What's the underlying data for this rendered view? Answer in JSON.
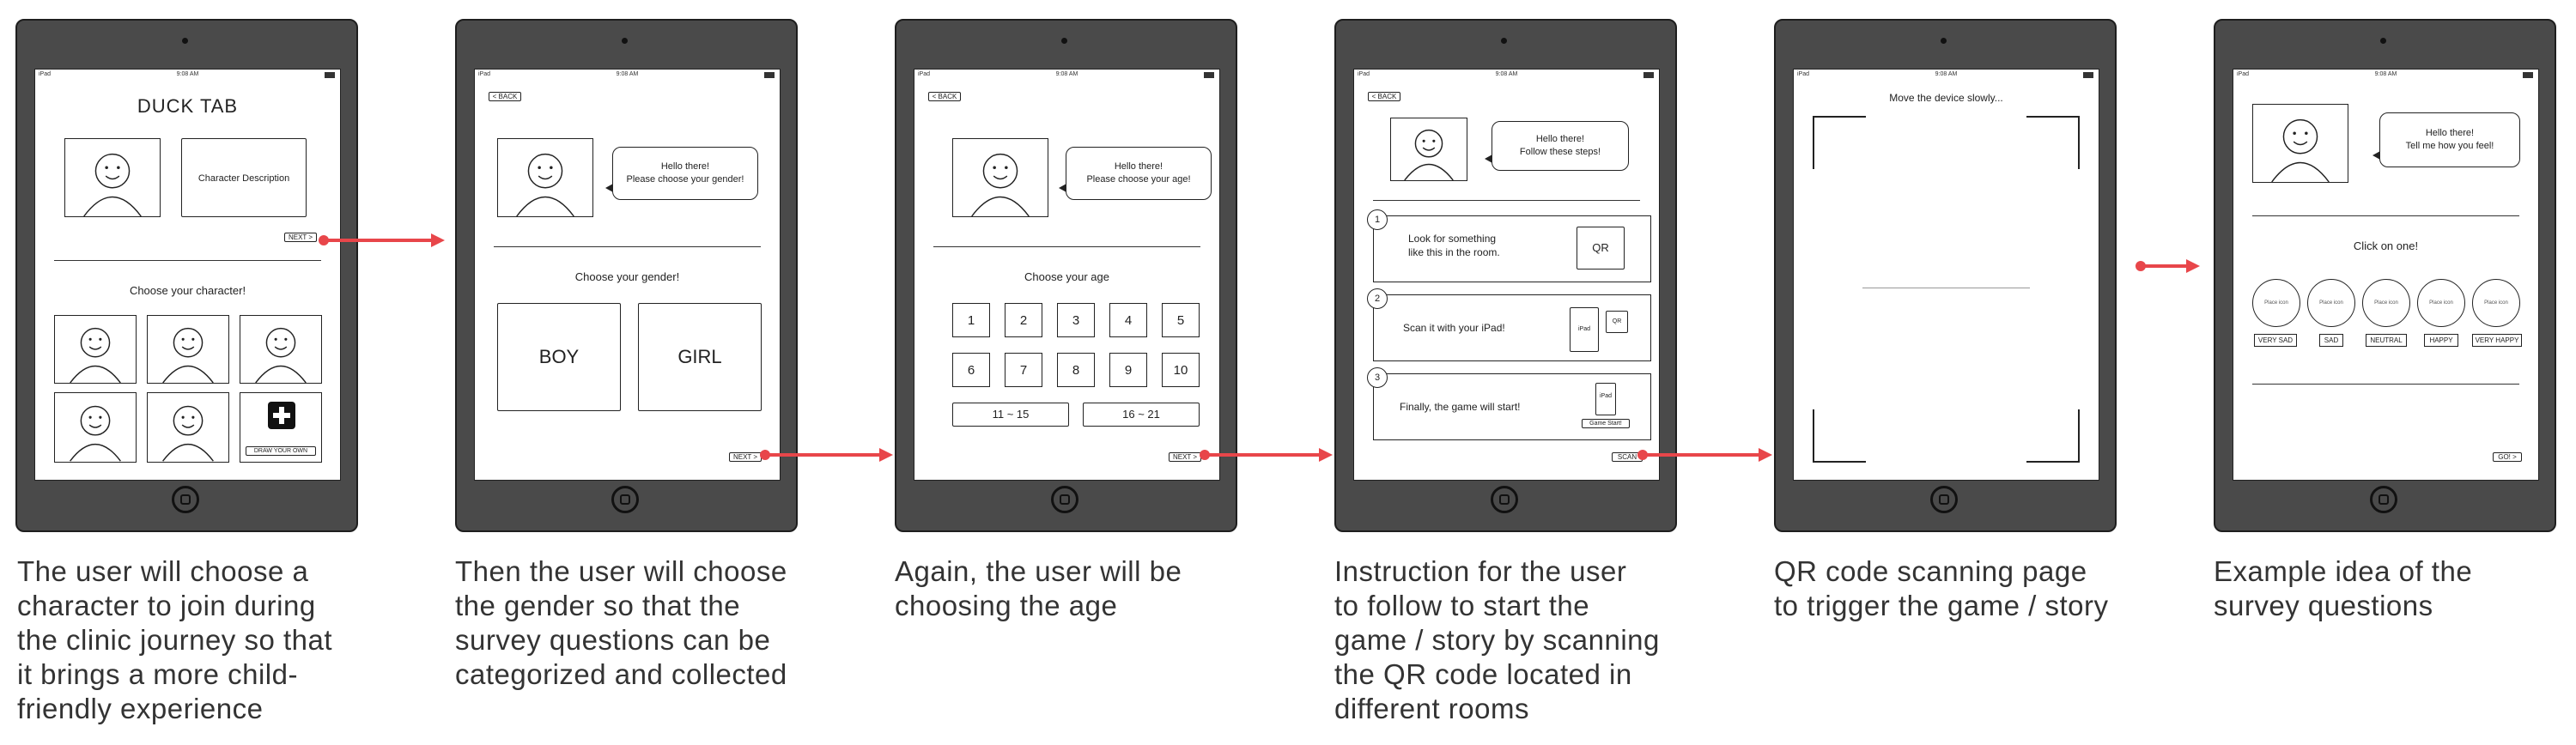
{
  "status": {
    "carrier": "iPad",
    "time": "9:08 AM"
  },
  "screen1": {
    "title": "DUCK TAB",
    "description": "Character Description",
    "next": "NEXT >",
    "choose": "Choose your character!",
    "draw_own": "DRAW YOUR OWN"
  },
  "screen2": {
    "back": "< BACK",
    "bubble": "Hello there!\nPlease choose your gender!",
    "choose": "Choose your gender!",
    "boy": "BOY",
    "girl": "GIRL",
    "next": "NEXT >"
  },
  "screen3": {
    "back": "< BACK",
    "bubble": "Hello there!\nPlease choose your age!",
    "choose": "Choose your age",
    "ages": [
      "1",
      "2",
      "3",
      "4",
      "5",
      "6",
      "7",
      "8",
      "9",
      "10"
    ],
    "range1": "11 ~ 15",
    "range2": "16 ~ 21",
    "next": "NEXT >"
  },
  "screen4": {
    "back": "< BACK",
    "bubble": "Hello there!\nFollow these steps!",
    "steps": [
      {
        "num": "1",
        "text": "Look for something\nlike this in the room.",
        "icon": "QR"
      },
      {
        "num": "2",
        "text": "Scan it with your iPad!",
        "device": "iPad",
        "icon": "QR"
      },
      {
        "num": "3",
        "text": "Finally, the game will start!",
        "device": "iPad",
        "button": "Game Start!"
      }
    ],
    "scan": "SCAN"
  },
  "screen5": {
    "instruction": "Move the device slowly..."
  },
  "screen6": {
    "bubble": "Hello there!\nTell me how you feel!",
    "click": "Click on one!",
    "placeholder": "Place icon",
    "moods": [
      "VERY SAD",
      "SAD",
      "NEUTRAL",
      "HAPPY",
      "VERY HAPPY"
    ],
    "go": "GO! >"
  },
  "captions": [
    "The user will choose a\ncharacter to join during\nthe clinic journey so that\nit brings a more child-\nfriendly experience",
    "Then the user will choose\nthe gender so that the\nsurvey questions can be\ncategorized and collected",
    "Again, the user will be\nchoosing the age",
    "Instruction for the user\nto follow to start the\ngame / story by scanning\nthe QR code located in\ndifferent rooms",
    "QR code scanning page\nto trigger the game / story",
    "Example idea of the\nsurvey questions"
  ],
  "colors": {
    "accent": "#e8464a",
    "device": "#4a4a4a"
  }
}
